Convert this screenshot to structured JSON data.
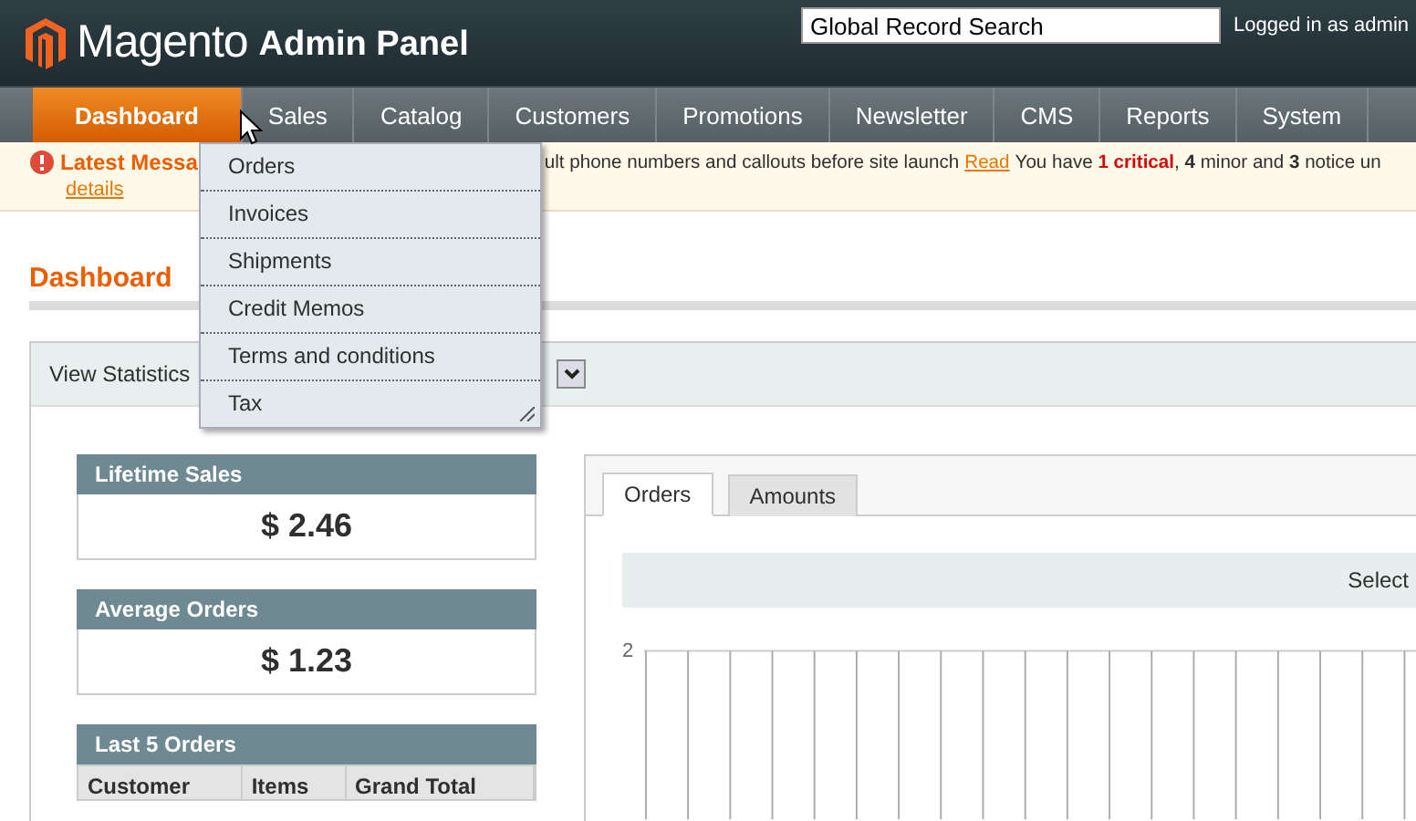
{
  "header": {
    "logo_text": "Magento",
    "logo_subtitle": "Admin Panel",
    "search": {
      "value": "Global Record Search"
    },
    "user": "Logged in as admin"
  },
  "nav": [
    {
      "label": "Dashboard",
      "selected": true
    },
    {
      "label": "Sales",
      "selected": false
    },
    {
      "label": "Catalog",
      "selected": false
    },
    {
      "label": "Customers",
      "selected": false
    },
    {
      "label": "Promotions",
      "selected": false
    },
    {
      "label": "Newsletter",
      "selected": false
    },
    {
      "label": "CMS",
      "selected": false
    },
    {
      "label": "Reports",
      "selected": false
    },
    {
      "label": "System",
      "selected": false
    }
  ],
  "sales_menu": [
    "Orders",
    "Invoices",
    "Shipments",
    "Credit Memos",
    "Terms and conditions",
    "Tax"
  ],
  "message": {
    "title": "Latest Messa",
    "text": "ult phone numbers and callouts before site launch",
    "link": "Read",
    "summary": "You have **1 critical**, **4** minor and **3** notice un",
    "details": "details"
  },
  "page_title": "Dashboard",
  "view_statistics": {
    "label": "View Statistics"
  },
  "stats": [
    {
      "title": "Lifetime Sales",
      "value": "$ 2.46"
    },
    {
      "title": "Average Orders",
      "value": "$ 1.23"
    }
  ],
  "last_orders": {
    "title": "Last 5 Orders",
    "columns": [
      "Customer",
      "Items",
      "Grand Total"
    ]
  },
  "chart_tabs": [
    {
      "label": "Orders",
      "selected": true
    },
    {
      "label": "Amounts",
      "selected": false
    }
  ],
  "chart_toolbar": {
    "label": "Select"
  },
  "chart": {
    "y_tick": "2"
  }
}
